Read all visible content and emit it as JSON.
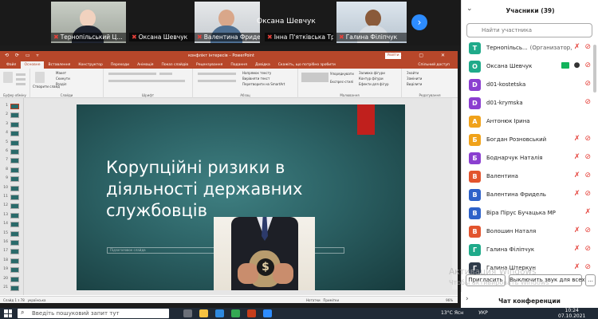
{
  "video_strip": {
    "tiles": [
      {
        "caption": "Тернопільський Ц...",
        "mic_muted": true
      },
      {
        "caption": "Оксана Шевчук",
        "mic_muted": true
      },
      {
        "caption": "Валентина Фридель",
        "mic_muted": true
      },
      {
        "caption": "Інна П'ятківська Тр...",
        "mic_muted": true
      },
      {
        "caption": "Галина Філіпчук",
        "mic_muted": true
      }
    ],
    "center_name": "Оксана Шевчук",
    "next_icon": "chevron-right-icon"
  },
  "ppt": {
    "qat": "⟲ ⟳ ▭ ▿",
    "window_title": "конфлікт інтересів – PowerPoint",
    "account_button": "Увійти",
    "window_controls": "– ▢ ✕",
    "tabs": [
      "Файл",
      "Основне",
      "Вставлення",
      "Конструктор",
      "Переходи",
      "Анімація",
      "Показ слайдів",
      "Рецензування",
      "Подання",
      "Довідка",
      "Скажіть, що потрібно зробити"
    ],
    "share_label": "Спільний доступ",
    "ribbon": {
      "groups": [
        "Буфер обміну",
        "Слайди",
        "Шрифт",
        "Абзац",
        "Малювання",
        "Редагування"
      ],
      "new_slide": "Створити слайд",
      "layout": "Макет",
      "reset": "Скинути",
      "section": "Розділ",
      "text_direction": "Напрямок тексту",
      "align_text": "Вирівняти текст",
      "smartart": "Перетворити на SmartArt",
      "arrange": "Упорядкувати",
      "quick_styles": "Експрес-стилі",
      "shape_fill": "Заливка фігури",
      "shape_outline": "Контур фігури",
      "shape_effects": "Ефекти для фігур",
      "find": "Знайти",
      "replace": "Замінити",
      "select": "Виділити"
    },
    "thumbnail_count": 21,
    "selected_thumbnail": 1,
    "slide": {
      "title": "Корупційні ризики в діяльності державних службовців",
      "subtitle": "Підзаголовок слайда",
      "image_symbol": "$"
    },
    "status": {
      "slide_info": "Слайд 1 з 78",
      "language": "українська",
      "notes": "Нотатки",
      "comments": "Примітки",
      "zoom": "96%"
    }
  },
  "participants": {
    "title": "Учасники (39)",
    "search_placeholder": "Найти участника",
    "list": [
      {
        "initial": "Т",
        "color": "#1faa8a",
        "name": "Тернопільсь...",
        "role": "(Организатор, я)",
        "share": false,
        "mic": "muted",
        "cam": "off"
      },
      {
        "initial": "О",
        "color": "#1faa8a",
        "name": "Оксана Шевчук",
        "role": "",
        "share": true,
        "mic": "on",
        "cam": "off"
      },
      {
        "initial": "D",
        "color": "#8b3fd0",
        "name": "d01-kostetska",
        "role": "",
        "share": false,
        "mic": "none",
        "cam": "off"
      },
      {
        "initial": "D",
        "color": "#8b3fd0",
        "name": "d01-krymska",
        "role": "",
        "share": false,
        "mic": "none",
        "cam": "off"
      },
      {
        "initial": "А",
        "color": "#f0a21a",
        "name": "Антонюк Ірина",
        "role": "",
        "share": false,
        "mic": "none",
        "cam": "none"
      },
      {
        "initial": "Б",
        "color": "#f0a21a",
        "name": "Богдан Розновський",
        "role": "",
        "share": false,
        "mic": "muted",
        "cam": "off"
      },
      {
        "initial": "Б",
        "color": "#8b3fd0",
        "name": "Боднарчук Наталія",
        "role": "",
        "share": false,
        "mic": "muted",
        "cam": "off"
      },
      {
        "initial": "В",
        "color": "#e2542e",
        "name": "Валентина",
        "role": "",
        "share": false,
        "mic": "muted",
        "cam": "off"
      },
      {
        "initial": "В",
        "color": "#2e62c9",
        "name": "Валентина Фридель",
        "role": "",
        "share": false,
        "mic": "muted",
        "cam": "off"
      },
      {
        "initial": "В",
        "color": "#2e62c9",
        "name": "Віра Пірус Бучацька МР",
        "role": "",
        "share": false,
        "mic": "muted",
        "cam": "none"
      },
      {
        "initial": "В",
        "color": "#e2542e",
        "name": "Волошин Наталя",
        "role": "",
        "share": false,
        "mic": "muted",
        "cam": "off"
      },
      {
        "initial": "Г",
        "color": "#1faa8a",
        "name": "Галина Філіпчук",
        "role": "",
        "share": false,
        "mic": "muted",
        "cam": "off"
      },
      {
        "initial": "Г",
        "color": "#2f3b4a",
        "name": "Галина Штеркун",
        "role": "",
        "share": false,
        "mic": "muted",
        "cam": "off"
      }
    ],
    "invite_button": "Пригласить",
    "mute_all_button": "Выключить звук для всех",
    "more_button": "...",
    "chat_title": "Чат конференции"
  },
  "watermark": {
    "line1": "Активация Windows",
    "line2": "Чтобы активировать Windows"
  },
  "taskbar": {
    "search_text": "Введіть пошуковий запит тут",
    "weather": "13°C",
    "lang": "Ясн",
    "right_lang": "УКР",
    "time": "10:24",
    "date": "07.10.2021"
  }
}
